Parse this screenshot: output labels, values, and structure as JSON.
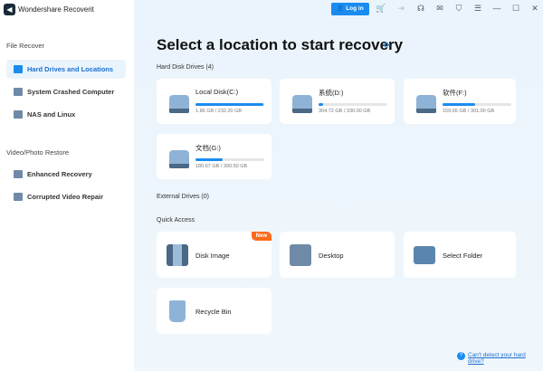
{
  "app": {
    "title": "Wondershare Recoverit"
  },
  "toolbar": {
    "login": "Log in"
  },
  "sidebar": {
    "section1": "File Recover",
    "items1": [
      {
        "label": "Hard Drives and Locations"
      },
      {
        "label": "System Crashed Computer"
      },
      {
        "label": "NAS and Linux"
      }
    ],
    "section2": "Video/Photo Restore",
    "items2": [
      {
        "label": "Enhanced Recovery"
      },
      {
        "label": "Corrupted Video Repair"
      }
    ]
  },
  "main": {
    "title": "Select a location to start recovery",
    "hard_disk_label": "Hard Disk Drives (4)",
    "drives": [
      {
        "name": "Local Disk(C:)",
        "size": "1.86 GB / 232.20 GB",
        "usage_pct": 99
      },
      {
        "name": "系统(D:)",
        "size": "304.72 GB / 330.00 GB",
        "usage_pct": 6
      },
      {
        "name": "软件(F:)",
        "size": "159.65 GB / 301.00 GB",
        "usage_pct": 47
      },
      {
        "name": "文档(G:)",
        "size": "180.67 GB / 300.50 GB",
        "usage_pct": 39
      }
    ],
    "external_label": "External Drives (0)",
    "quick_label": "Quick Access",
    "quick": [
      {
        "name": "Disk Image",
        "badge": "New"
      },
      {
        "name": "Desktop"
      },
      {
        "name": "Select Folder"
      },
      {
        "name": "Recycle Bin"
      }
    ],
    "help_link": "Can't detect your hard drive?"
  },
  "colors": {
    "accent": "#1a8cf0",
    "badge": "#ff6a1a"
  }
}
